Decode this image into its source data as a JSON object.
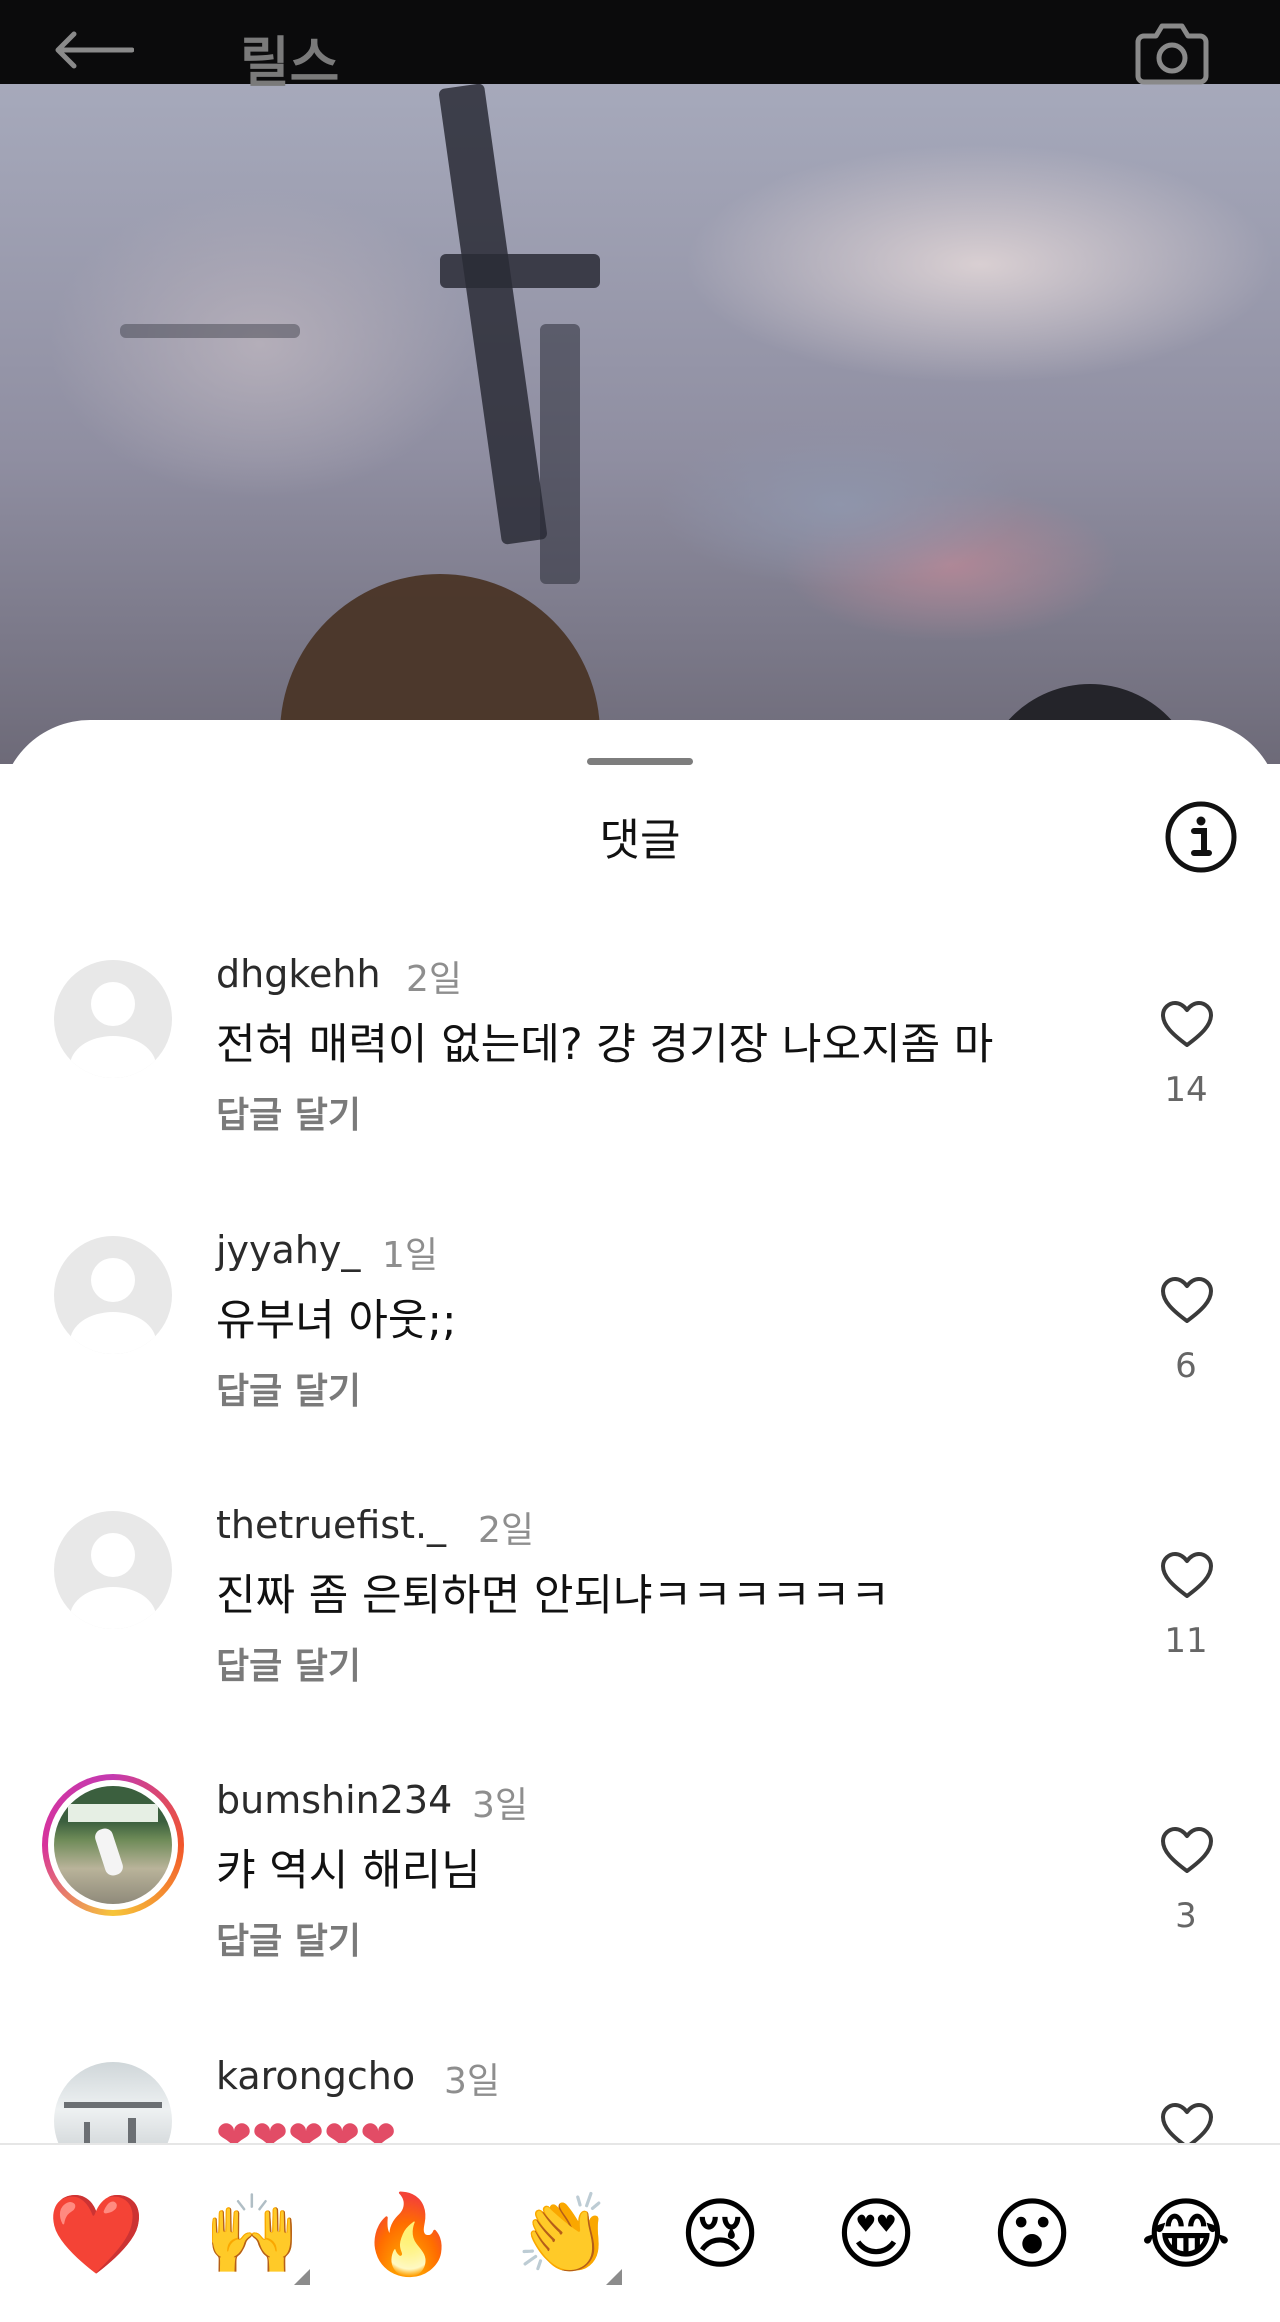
{
  "header": {
    "title": "릴스"
  },
  "sheet": {
    "title": "댓글"
  },
  "comments": [
    {
      "username": "dhgkehh",
      "time": "2일",
      "text": "전혀 매력이 없는데? 걍 경기장 나오지좀 마",
      "reply": "답글 달기",
      "likes": "14"
    },
    {
      "username": "jyyahy_",
      "time": "1일",
      "text": "유부녀 아웃;;",
      "reply": "답글 달기",
      "likes": "6"
    },
    {
      "username": "thetruefist._",
      "time": "2일",
      "text": "진짜 좀 은퇴하면 안되냐ㅋㅋㅋㅋㅋㅋ",
      "reply": "답글 달기",
      "likes": "11"
    },
    {
      "username": "bumshin234",
      "time": "3일",
      "text": "캬 역시 해리님",
      "reply": "답글 달기",
      "likes": "3"
    },
    {
      "username": "karongcho",
      "time": "3일",
      "text": "❤❤❤❤❤"
    }
  ],
  "emoji_bar": [
    "❤️",
    "🙌",
    "🔥",
    "👏",
    "😢",
    "😍",
    "😮",
    "😂"
  ],
  "icons": {
    "back": "arrow-left-icon",
    "camera": "camera-icon",
    "info": "info-icon",
    "like": "heart-outline-icon"
  }
}
